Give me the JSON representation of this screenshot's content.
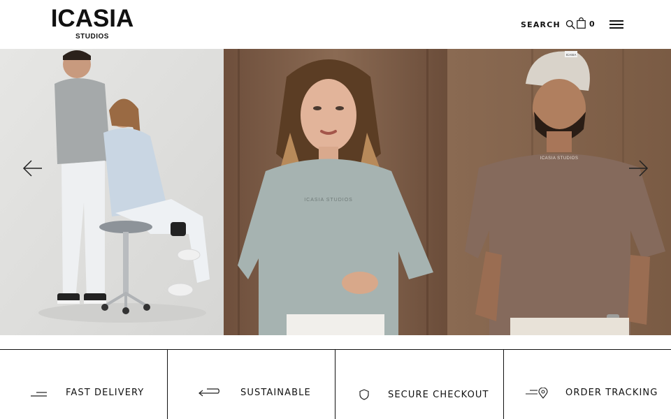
{
  "header": {
    "logo_main": "ICASIA",
    "logo_sub": "STUDIOS",
    "search_label": "SEARCH",
    "search_icon": "search-icon",
    "cart_icon": "shopping-bag-icon",
    "cart_count": "0",
    "menu_icon": "hamburger-menu-icon"
  },
  "hero": {
    "slides": [
      {
        "subject": "couple in light grey and light blue loungewear with stool"
      },
      {
        "subject": "woman in sage oversized t-shirt"
      },
      {
        "subject": "man in brown oversized t-shirt and beige beanie"
      }
    ],
    "shirt_print_2": "ICASIA STUDIOS",
    "shirt_print_3": "ICASIA STUDIOS",
    "beanie_tag": "ICASIA",
    "prev_icon": "arrow-left-icon",
    "next_icon": "arrow-right-icon"
  },
  "features": [
    {
      "label": "FAST DELIVERY",
      "icon": "delivery-lines-icon"
    },
    {
      "label": "SUSTAINABLE",
      "icon": "return-arrow-icon"
    },
    {
      "label": "SECURE CHECKOUT",
      "icon": "shield-icon"
    },
    {
      "label": "ORDER TRACKING",
      "icon": "location-pin-icon"
    }
  ],
  "colors": {
    "text": "#111111",
    "background": "#ffffff",
    "slide1_bg": "#e3e3e1",
    "slide2_bg": "#7a5c47",
    "slide3_bg": "#8e6b52",
    "shirt_sage": "#a6b3b1",
    "shirt_brown": "#856a5c"
  }
}
